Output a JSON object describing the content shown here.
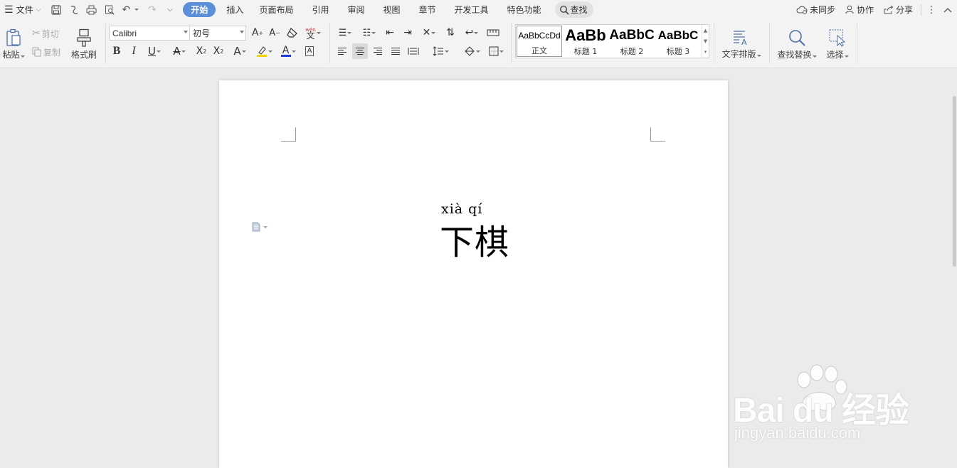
{
  "menu": {
    "file_label": "文件",
    "tabs": [
      {
        "label": "开始",
        "active": true
      },
      {
        "label": "插入"
      },
      {
        "label": "页面布局"
      },
      {
        "label": "引用"
      },
      {
        "label": "审阅"
      },
      {
        "label": "视图"
      },
      {
        "label": "章节"
      },
      {
        "label": "开发工具"
      },
      {
        "label": "特色功能"
      }
    ],
    "search_label": "查找",
    "sync_label": "未同步",
    "collab_label": "协作",
    "share_label": "分享"
  },
  "ribbon": {
    "paste_label": "粘贴",
    "cut_label": "剪切",
    "copy_label": "复制",
    "format_painter_label": "格式刷",
    "font_name": "Calibri",
    "font_size": "初号",
    "styles": [
      {
        "preview": "AaBbCcDd",
        "name": "正文",
        "selected": true
      },
      {
        "preview": "AaBb",
        "name": "标题 1"
      },
      {
        "preview": "AaBbC",
        "name": "标题 2"
      },
      {
        "preview": "AaBbC",
        "name": "标题 3"
      }
    ],
    "text_layout_label": "文字排版",
    "find_replace_label": "查找替换",
    "select_label": "选择",
    "phonetic_glyph": "wén"
  },
  "document": {
    "pinyin": "xià  qí",
    "text": "下棋"
  },
  "watermark": {
    "brand": "Bai du 经验",
    "url": "jingyan.baidu.com"
  },
  "colors": {
    "accent": "#5b8fd9",
    "highlight": "#f5d000",
    "font_color": "#1f3ad6"
  }
}
